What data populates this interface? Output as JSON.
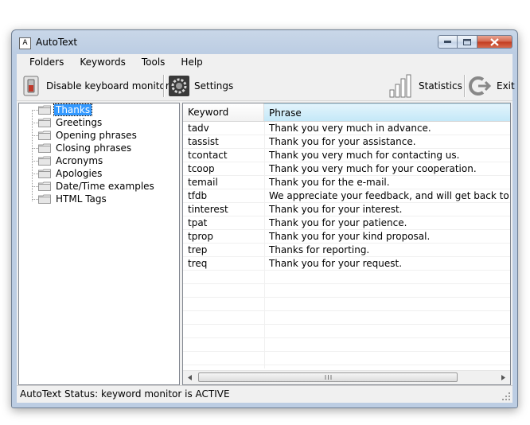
{
  "window": {
    "title": "AutoText",
    "icon_glyph": "A"
  },
  "menu": [
    "Folders",
    "Keywords",
    "Tools",
    "Help"
  ],
  "toolbar": {
    "disable_label": "Disable keyboard monitor",
    "settings_label": "Settings",
    "statistics_label": "Statistics",
    "exit_label": "Exit"
  },
  "folders": [
    {
      "label": "Thanks",
      "selected": true
    },
    {
      "label": "Greetings"
    },
    {
      "label": "Opening phrases"
    },
    {
      "label": "Closing phrases"
    },
    {
      "label": "Acronyms"
    },
    {
      "label": "Apologies"
    },
    {
      "label": "Date/Time examples"
    },
    {
      "label": "HTML Tags"
    }
  ],
  "table": {
    "columns": [
      "Keyword",
      "Phrase"
    ],
    "rows": [
      {
        "keyword": "tadv",
        "phrase": "Thank you very much in advance."
      },
      {
        "keyword": "tassist",
        "phrase": "Thank you for your assistance."
      },
      {
        "keyword": "tcontact",
        "phrase": "Thank you very much for contacting us."
      },
      {
        "keyword": "tcoop",
        "phrase": "Thank you very much for your cooperation."
      },
      {
        "keyword": "temail",
        "phrase": "Thank you for the e-mail."
      },
      {
        "keyword": "tfdb",
        "phrase": "We appreciate your feedback, and will get back to you as soon a"
      },
      {
        "keyword": "tinterest",
        "phrase": "Thank you for your interest."
      },
      {
        "keyword": "tpat",
        "phrase": "Thank you for your patience."
      },
      {
        "keyword": "tprop",
        "phrase": "Thank you for your kind proposal."
      },
      {
        "keyword": "trep",
        "phrase": "Thanks for reporting."
      },
      {
        "keyword": "treq",
        "phrase": "Thank you for your request."
      }
    ]
  },
  "status": {
    "text": "AutoText Status: keyword monitor is ACTIVE"
  },
  "colors": {
    "selection": "#3399ff",
    "title_bar": "#bccde3",
    "close_button": "#c23b1f",
    "header_highlight": "#c4e8f8"
  }
}
